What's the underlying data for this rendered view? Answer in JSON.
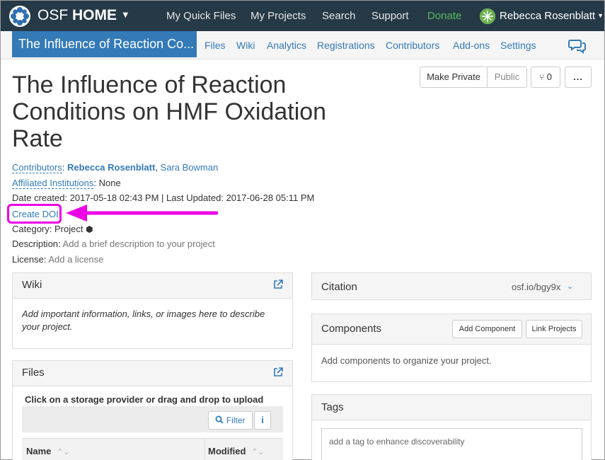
{
  "nav": {
    "brand_prefix": "OSF",
    "brand_main": "HOME",
    "links": [
      "My Quick Files",
      "My Projects",
      "Search",
      "Support",
      "Donate"
    ],
    "user_name": "Rebecca Rosenblatt"
  },
  "project_bar": {
    "title": "The Influence of Reaction Co...",
    "tabs": [
      "Files",
      "Wiki",
      "Analytics",
      "Registrations",
      "Contributors",
      "Add-ons",
      "Settings"
    ]
  },
  "header_buttons": {
    "make_private": "Make Private",
    "public": "Public",
    "fork_count": "0",
    "more": "..."
  },
  "project": {
    "title": "The Influence of Reaction Conditions on HMF Oxidation Rate",
    "contributors_label": "Contributors",
    "contributor_1": "Rebecca Rosenblatt",
    "contributor_2": "Sara Bowman",
    "affiliated_label": "Affiliated Institutions",
    "affiliated_value": "None",
    "dates": "Date created: 2017-05-18 02:43 PM | Last Updated: 2017-06-28 05:11 PM",
    "create_doi": "Create DOI",
    "category_label": "Category:",
    "category_value": "Project",
    "description_label": "Description:",
    "description_value": "Add a brief description to your project",
    "license_label": "License:",
    "license_value": "Add a license"
  },
  "wiki": {
    "title": "Wiki",
    "body": "Add important information, links, or images here to describe your project."
  },
  "files": {
    "title": "Files",
    "instruction": "Click on a storage provider or drag and drop to upload",
    "filter": "Filter",
    "info": "i",
    "col_name": "Name",
    "col_modified": "Modified"
  },
  "citation": {
    "title": "Citation",
    "link": "osf.io/bgy9x"
  },
  "components": {
    "title": "Components",
    "add": "Add Component",
    "link": "Link Projects",
    "body": "Add components to organize your project."
  },
  "tags": {
    "title": "Tags",
    "placeholder": "add a tag to enhance discoverability"
  },
  "colors": {
    "nav_bg": "#263947",
    "accent": "#337ab7",
    "highlight": "#ec00e6",
    "donate": "#5cb85c"
  }
}
